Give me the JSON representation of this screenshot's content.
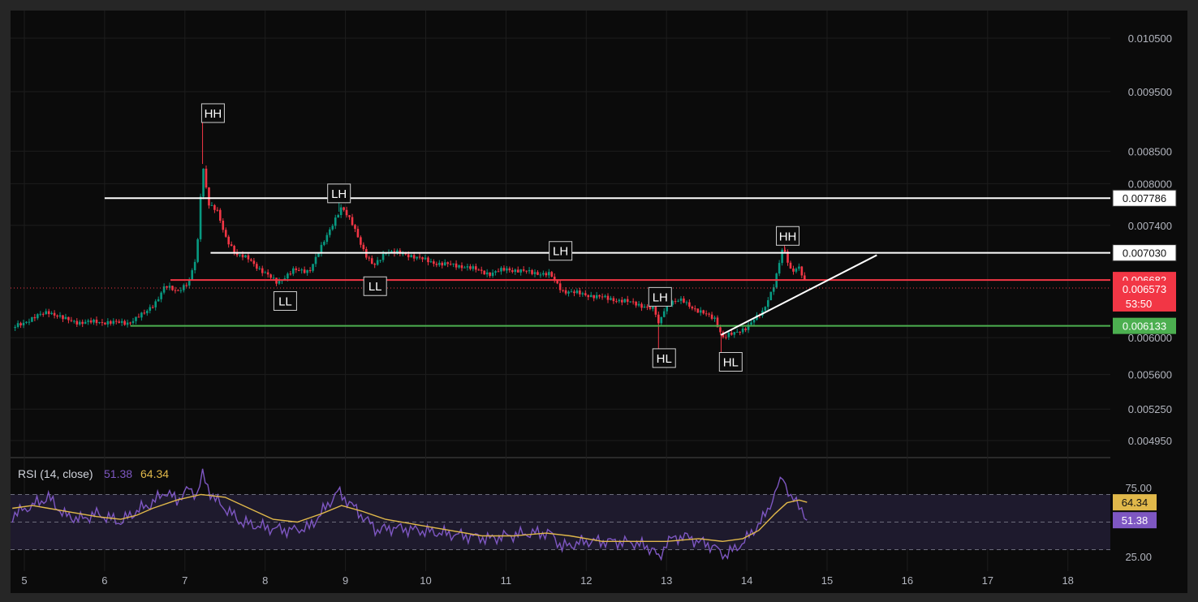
{
  "chart_data": [
    {
      "type": "candlestick",
      "x_axis": {
        "ticks": [
          "5",
          "6",
          "7",
          "8",
          "9",
          "10",
          "11",
          "12",
          "13",
          "14",
          "15",
          "16",
          "17",
          "18"
        ]
      },
      "y_axis": {
        "scale": "log",
        "ticks": [
          "0.010500",
          "0.009500",
          "0.008500",
          "0.008000",
          "0.007400",
          "0.006000",
          "0.005600",
          "0.005250",
          "0.004950"
        ],
        "range": [
          0.0047,
          0.0112
        ]
      },
      "price_series": [
        {
          "x": 4.85,
          "y": 0.00611
        },
        {
          "x": 5.1,
          "y": 0.00622
        },
        {
          "x": 5.3,
          "y": 0.0063
        },
        {
          "x": 5.5,
          "y": 0.00621
        },
        {
          "x": 5.7,
          "y": 0.00617
        },
        {
          "x": 5.9,
          "y": 0.00618
        },
        {
          "x": 6.1,
          "y": 0.00617
        },
        {
          "x": 6.3,
          "y": 0.00617
        },
        {
          "x": 6.5,
          "y": 0.00628
        },
        {
          "x": 6.65,
          "y": 0.00643
        },
        {
          "x": 6.75,
          "y": 0.0066
        },
        {
          "x": 6.9,
          "y": 0.00655
        },
        {
          "x": 7.05,
          "y": 0.00665
        },
        {
          "x": 7.15,
          "y": 0.007
        },
        {
          "x": 7.22,
          "y": 0.0083
        },
        {
          "x": 7.3,
          "y": 0.0077
        },
        {
          "x": 7.4,
          "y": 0.0076
        },
        {
          "x": 7.5,
          "y": 0.00725
        },
        {
          "x": 7.65,
          "y": 0.007
        },
        {
          "x": 7.8,
          "y": 0.00695
        },
        {
          "x": 7.95,
          "y": 0.0068
        },
        {
          "x": 8.15,
          "y": 0.00665
        },
        {
          "x": 8.35,
          "y": 0.0068
        },
        {
          "x": 8.55,
          "y": 0.0068
        },
        {
          "x": 8.7,
          "y": 0.0071
        },
        {
          "x": 8.85,
          "y": 0.00745
        },
        {
          "x": 8.95,
          "y": 0.00765
        },
        {
          "x": 9.1,
          "y": 0.0074
        },
        {
          "x": 9.25,
          "y": 0.007
        },
        {
          "x": 9.35,
          "y": 0.00685
        },
        {
          "x": 9.5,
          "y": 0.00705
        },
        {
          "x": 9.8,
          "y": 0.007
        },
        {
          "x": 10.1,
          "y": 0.0069
        },
        {
          "x": 10.5,
          "y": 0.00685
        },
        {
          "x": 10.8,
          "y": 0.00676
        },
        {
          "x": 11.0,
          "y": 0.00682
        },
        {
          "x": 11.3,
          "y": 0.00678
        },
        {
          "x": 11.55,
          "y": 0.00675
        },
        {
          "x": 11.7,
          "y": 0.00655
        },
        {
          "x": 12.0,
          "y": 0.0065
        },
        {
          "x": 12.3,
          "y": 0.00645
        },
        {
          "x": 12.6,
          "y": 0.0064
        },
        {
          "x": 12.85,
          "y": 0.00632
        },
        {
          "x": 12.9,
          "y": 0.00615
        },
        {
          "x": 13.0,
          "y": 0.0064
        },
        {
          "x": 13.2,
          "y": 0.00643
        },
        {
          "x": 13.4,
          "y": 0.0063
        },
        {
          "x": 13.6,
          "y": 0.00622
        },
        {
          "x": 13.7,
          "y": 0.006
        },
        {
          "x": 13.85,
          "y": 0.00605
        },
        {
          "x": 14.0,
          "y": 0.00612
        },
        {
          "x": 14.2,
          "y": 0.0063
        },
        {
          "x": 14.35,
          "y": 0.00665
        },
        {
          "x": 14.45,
          "y": 0.0071
        },
        {
          "x": 14.55,
          "y": 0.0068
        },
        {
          "x": 14.65,
          "y": 0.00685
        },
        {
          "x": 14.75,
          "y": 0.00657
        }
      ],
      "horizontal_levels": [
        {
          "price": 0.007786,
          "label": "0.007786",
          "color": "#ffffff",
          "line_color": "#ffffff",
          "x_start": 6.0,
          "x_end": 18.5
        },
        {
          "price": 0.00703,
          "label": "0.007030",
          "color": "#ffffff",
          "line_color": "#ffffff",
          "x_start": 7.32,
          "x_end": 18.5
        },
        {
          "price": 0.006682,
          "label": "0.006682",
          "color": "#f23645",
          "line_color": "#f23645",
          "x_start": 6.82,
          "x_end": 18.5
        },
        {
          "price": 0.006133,
          "label": "0.006133",
          "color": "#4caf50",
          "line_color": "#4caf50",
          "x_start": 6.32,
          "x_end": 18.5
        }
      ],
      "trendline": {
        "x1": 13.68,
        "y1": 0.00603,
        "x2": 15.62,
        "y2": 0.007,
        "color": "#ffffff"
      },
      "current_price": {
        "label": "0.006573",
        "countdown": "53:50",
        "color": "#f23645"
      },
      "annotations": [
        {
          "text": "HH",
          "x": 7.35,
          "y": 0.00912
        },
        {
          "text": "LL",
          "x": 8.25,
          "y": 0.00642
        },
        {
          "text": "LH",
          "x": 8.92,
          "y": 0.00785
        },
        {
          "text": "LL",
          "x": 9.37,
          "y": 0.0066
        },
        {
          "text": "LH",
          "x": 11.68,
          "y": 0.00705
        },
        {
          "text": "LH",
          "x": 12.92,
          "y": 0.00647
        },
        {
          "text": "HL",
          "x": 12.97,
          "y": 0.00577
        },
        {
          "text": "HH",
          "x": 14.51,
          "y": 0.00725
        },
        {
          "text": "HL",
          "x": 13.8,
          "y": 0.00573
        }
      ]
    },
    {
      "type": "line",
      "title": "RSI (14, close)",
      "values_shown": [
        "51.38",
        "64.34"
      ],
      "y_axis": {
        "ticks": [
          "75.00",
          "25.00"
        ],
        "range": [
          13,
          93
        ]
      },
      "bands": {
        "upper": 70,
        "middle": 50,
        "lower": 30
      },
      "series": [
        {
          "name": "RSI",
          "color": "#7e57c2",
          "label": "51.38",
          "points": [
            [
              4.85,
              55
            ],
            [
              5.1,
              62
            ],
            [
              5.3,
              68
            ],
            [
              5.5,
              55
            ],
            [
              5.7,
              52
            ],
            [
              5.9,
              56
            ],
            [
              6.2,
              50
            ],
            [
              6.4,
              58
            ],
            [
              6.6,
              64
            ],
            [
              6.75,
              72
            ],
            [
              6.9,
              66
            ],
            [
              7.05,
              74
            ],
            [
              7.15,
              70
            ],
            [
              7.22,
              84
            ],
            [
              7.35,
              68
            ],
            [
              7.5,
              60
            ],
            [
              7.7,
              50
            ],
            [
              8.0,
              46
            ],
            [
              8.3,
              44
            ],
            [
              8.55,
              46
            ],
            [
              8.75,
              60
            ],
            [
              8.9,
              72
            ],
            [
              9.05,
              64
            ],
            [
              9.25,
              52
            ],
            [
              9.4,
              44
            ],
            [
              9.6,
              46
            ],
            [
              9.9,
              44
            ],
            [
              10.2,
              42
            ],
            [
              10.5,
              40
            ],
            [
              10.8,
              38
            ],
            [
              11.0,
              40
            ],
            [
              11.3,
              42
            ],
            [
              11.55,
              42
            ],
            [
              11.7,
              32
            ],
            [
              12.0,
              36
            ],
            [
              12.3,
              36
            ],
            [
              12.6,
              35
            ],
            [
              12.85,
              30
            ],
            [
              12.9,
              22
            ],
            [
              13.0,
              36
            ],
            [
              13.2,
              40
            ],
            [
              13.4,
              36
            ],
            [
              13.6,
              32
            ],
            [
              13.7,
              26
            ],
            [
              13.85,
              30
            ],
            [
              14.0,
              38
            ],
            [
              14.2,
              52
            ],
            [
              14.35,
              70
            ],
            [
              14.45,
              84
            ],
            [
              14.55,
              66
            ],
            [
              14.65,
              64
            ],
            [
              14.75,
              51.38
            ]
          ]
        },
        {
          "name": "RSI-based MA",
          "color": "#e0b84a",
          "label": "64.34",
          "points": [
            [
              4.85,
              60
            ],
            [
              5.1,
              62
            ],
            [
              5.3,
              60
            ],
            [
              5.5,
              58
            ],
            [
              5.7,
              56
            ],
            [
              5.9,
              54
            ],
            [
              6.2,
              52
            ],
            [
              6.4,
              55
            ],
            [
              6.6,
              60
            ],
            [
              6.9,
              66
            ],
            [
              7.2,
              70
            ],
            [
              7.5,
              68
            ],
            [
              7.8,
              60
            ],
            [
              8.1,
              52
            ],
            [
              8.4,
              50
            ],
            [
              8.7,
              56
            ],
            [
              8.95,
              62
            ],
            [
              9.2,
              58
            ],
            [
              9.5,
              52
            ],
            [
              9.9,
              48
            ],
            [
              10.3,
              44
            ],
            [
              10.7,
              40
            ],
            [
              11.1,
              40
            ],
            [
              11.5,
              42
            ],
            [
              11.8,
              40
            ],
            [
              12.2,
              36
            ],
            [
              12.6,
              36
            ],
            [
              13.0,
              36
            ],
            [
              13.4,
              38
            ],
            [
              13.7,
              36
            ],
            [
              13.95,
              38
            ],
            [
              14.15,
              44
            ],
            [
              14.35,
              56
            ],
            [
              14.5,
              64
            ],
            [
              14.65,
              66
            ],
            [
              14.75,
              64.34
            ]
          ]
        }
      ]
    }
  ],
  "colors": {
    "background": "#0b0b0b",
    "grid": "#1d1d1d",
    "candle_up": "#089981",
    "candle_down": "#f23645",
    "axis_text": "#b2b5be",
    "rsi_band": "#1e1a2d"
  }
}
